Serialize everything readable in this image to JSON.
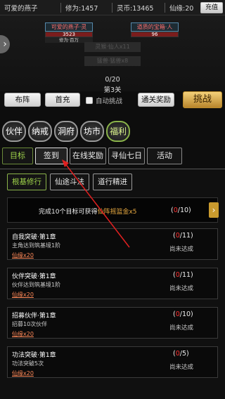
{
  "topbar": {
    "player_name": "可爱的燕子",
    "power_label": "修为:",
    "power_value": "1457",
    "coins_label": "灵币:",
    "coins_value": "13465",
    "jade_label": "仙缘:",
    "jade_value": "20",
    "recharge_label": "充值"
  },
  "battle": {
    "player_name": "可爱的燕子·灵",
    "player_hp": "3523",
    "player_sub": "修为·百万",
    "enemy_name": "道质的宝箱·人",
    "enemy_hp": "96",
    "ghost_1": "灵猴·仙人x11",
    "ghost_2": "猛兽·猛兽x8",
    "progress": "0/20",
    "stage": "第3关"
  },
  "actions": {
    "formation": "布阵",
    "first_recharge": "首充",
    "auto_challenge": "自动挑战",
    "clear_reward": "通关奖励",
    "challenge": "挑战"
  },
  "nav": [
    "伙伴",
    "纳戒",
    "洞府",
    "坊市",
    "福利"
  ],
  "tabs": [
    "目标",
    "签到",
    "在线奖励",
    "寻仙七日",
    "活动"
  ],
  "subtabs": [
    "根基修行",
    "仙途斗法",
    "道行精进"
  ],
  "summary": {
    "prefix": "完成10个目标可获得",
    "reward": "仙阵摇篮金x5",
    "count_open": "(",
    "count_value": "0",
    "count_close": "/10)"
  },
  "quests": [
    {
      "title": "自我突破·第1章",
      "desc": "主角达到筑基境1阶",
      "reward": "仙缘x20",
      "cur": "0",
      "total": "/11)",
      "status": "尚未达成"
    },
    {
      "title": "伙伴突破·第1章",
      "desc": "伙伴达到筑基境1阶",
      "reward": "仙缘x20",
      "cur": "0",
      "total": "/11)",
      "status": "尚未达成"
    },
    {
      "title": "招募伙伴·第1章",
      "desc": "招募10次伙伴",
      "reward": "仙缘x20",
      "cur": "0",
      "total": "/10)",
      "status": "尚未达成"
    },
    {
      "title": "功法突破·第1章",
      "desc": "功法突破5次",
      "reward": "仙缘x20",
      "cur": "0",
      "total": "/5)",
      "status": "尚未达成"
    }
  ],
  "colors": {
    "accent_green": "#9ed24a",
    "gold": "#e6a840",
    "progress_red": "#ff3333",
    "annotation_red": "#e02020"
  }
}
